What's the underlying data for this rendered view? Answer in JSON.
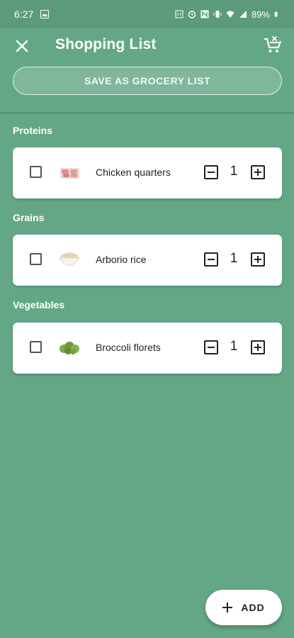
{
  "status_bar": {
    "time": "6:27",
    "battery": "89%",
    "icons": [
      "photo-icon",
      "nfc-icon",
      "alarm-icon",
      "nfc-n-icon",
      "vibrate-icon",
      "wifi-icon",
      "signal-icon",
      "battery-icon"
    ]
  },
  "app_bar": {
    "title": "Shopping List",
    "close_icon": "close-icon",
    "cart_icon": "clear-cart-icon",
    "save_button_label": "SAVE AS GROCERY LIST"
  },
  "sections": [
    {
      "title": "Proteins",
      "items": [
        {
          "name": "Chicken quarters",
          "quantity": "1",
          "checked": false,
          "thumbnail": "chicken-image"
        }
      ]
    },
    {
      "title": "Grains",
      "items": [
        {
          "name": "Arborio rice",
          "quantity": "1",
          "checked": false,
          "thumbnail": "rice-image"
        }
      ]
    },
    {
      "title": "Vegetables",
      "items": [
        {
          "name": "Broccoli florets",
          "quantity": "1",
          "checked": false,
          "thumbnail": "broccoli-image"
        }
      ]
    }
  ],
  "fab": {
    "label": "ADD",
    "icon": "plus-icon"
  },
  "colors": {
    "background": "#64a787",
    "status_bar": "#5b9b7c",
    "card": "#ffffff",
    "text_dark": "#222222"
  }
}
